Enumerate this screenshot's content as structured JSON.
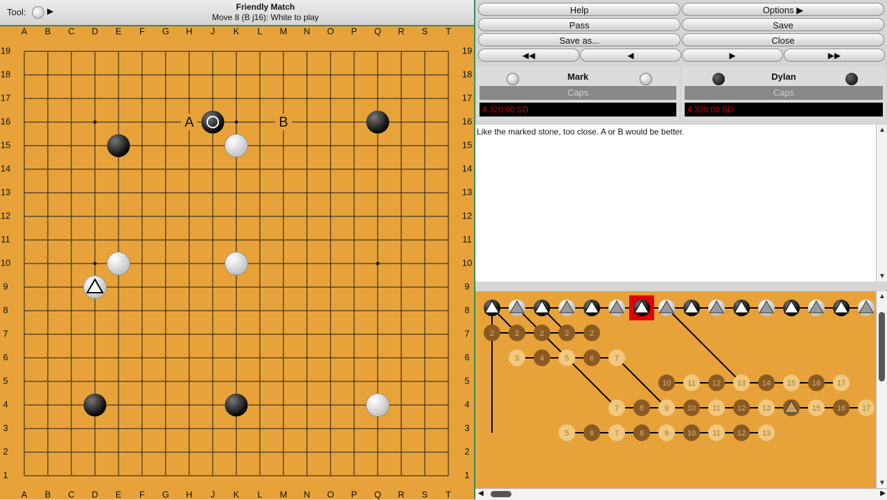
{
  "toolbar": {
    "tool_label": "Tool:",
    "tool_icon": "white-stone-icon",
    "tool_arrow": "▶"
  },
  "game": {
    "title": "Friendly Match",
    "status": "Move 8 (B j16): White to play"
  },
  "board": {
    "columns": [
      "A",
      "B",
      "C",
      "D",
      "E",
      "F",
      "G",
      "H",
      "J",
      "K",
      "L",
      "M",
      "N",
      "O",
      "P",
      "Q",
      "R",
      "S",
      "T"
    ],
    "rows": [
      "19",
      "18",
      "17",
      "16",
      "15",
      "14",
      "13",
      "12",
      "11",
      "10",
      "9",
      "8",
      "7",
      "6",
      "5",
      "4",
      "3",
      "2",
      "1"
    ],
    "colors": {
      "wood": "#e7a33a",
      "line": "#1a1a1a",
      "black": "#111111",
      "white": "#f2f2f2"
    },
    "hoshi": [
      "D16",
      "K16",
      "Q16",
      "D10",
      "K10",
      "Q10",
      "D4",
      "K4",
      "Q4"
    ],
    "stones": [
      {
        "color": "black",
        "point": "J16",
        "marker": "circle"
      },
      {
        "color": "black",
        "point": "Q16"
      },
      {
        "color": "black",
        "point": "E15"
      },
      {
        "color": "white",
        "point": "K15"
      },
      {
        "color": "white",
        "point": "E10"
      },
      {
        "color": "white",
        "point": "K10"
      },
      {
        "color": "white",
        "point": "D9",
        "marker": "triangle"
      },
      {
        "color": "black",
        "point": "D4"
      },
      {
        "color": "black",
        "point": "K4"
      },
      {
        "color": "white",
        "point": "Q4"
      }
    ],
    "letters": [
      {
        "text": "A",
        "point": "H16"
      },
      {
        "text": "B",
        "point": "M16"
      }
    ]
  },
  "buttons": {
    "help": "Help",
    "options": "Options",
    "options_arrow": "▶",
    "pass": "Pass",
    "save": "Save",
    "save_as": "Save as...",
    "close": "Close"
  },
  "nav": {
    "first": "◀◀",
    "prev": "◀",
    "next": "▶",
    "last": "▶▶"
  },
  "players": [
    {
      "name": "Mark",
      "caps": "Caps",
      "clock": "4,320:00 SD",
      "stone": "white"
    },
    {
      "name": "Dylan",
      "caps": "Caps",
      "clock": "4,320:00 SD",
      "stone": "black"
    }
  ],
  "comment": "Like the marked stone, too close. A or B would be better.",
  "tree": {
    "main_line": [
      "black",
      "white",
      "black",
      "white",
      "black",
      "white",
      "black",
      "white",
      "black",
      "white",
      "black",
      "white",
      "black",
      "white",
      "black",
      "white"
    ],
    "current_index": 6,
    "branches": [
      {
        "labels": [
          "2",
          "2",
          "2",
          "2",
          "2"
        ],
        "shade": "dark"
      },
      {
        "labels": [
          "3",
          "4",
          "5",
          "6",
          "7"
        ]
      },
      {
        "labels": [
          "10",
          "11",
          "12",
          "13",
          "14",
          "15",
          "16",
          "17"
        ]
      },
      {
        "labels": [
          "7",
          "8",
          "9",
          "10",
          "11",
          "12",
          "13",
          "14",
          "15",
          "16",
          "17"
        ]
      },
      {
        "labels": [
          "5",
          "6",
          "7",
          "8",
          "9",
          "10",
          "11",
          "12",
          "13"
        ]
      }
    ]
  }
}
